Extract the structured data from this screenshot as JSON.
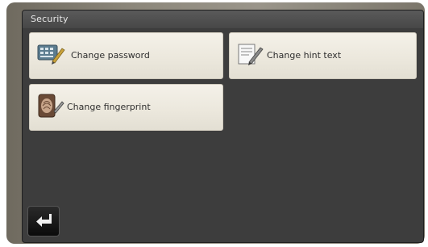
{
  "screen": {
    "title": "Security"
  },
  "menu": {
    "items": [
      {
        "label": "Change password",
        "icon": "password-keypad-icon"
      },
      {
        "label": "Change hint text",
        "icon": "hint-edit-icon"
      },
      {
        "label": "Change fingerprint",
        "icon": "fingerprint-icon"
      }
    ]
  },
  "footer": {
    "back_icon": "return-arrow-icon"
  }
}
